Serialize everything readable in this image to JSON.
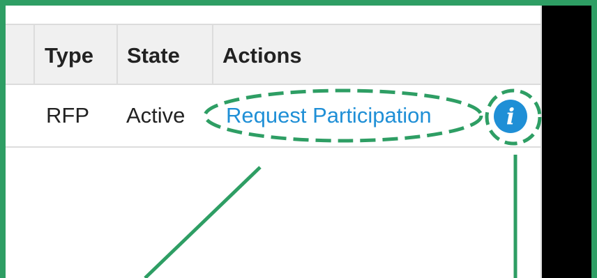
{
  "table": {
    "headers": {
      "type": "Type",
      "state": "State",
      "actions": "Actions"
    },
    "rows": [
      {
        "type": "RFP",
        "state": "Active",
        "action_link": "Request Participation",
        "info_icon": "info-icon"
      }
    ]
  },
  "annotation": {
    "highlight_color": "#2e9e64",
    "link_color": "#1f8fd6"
  }
}
